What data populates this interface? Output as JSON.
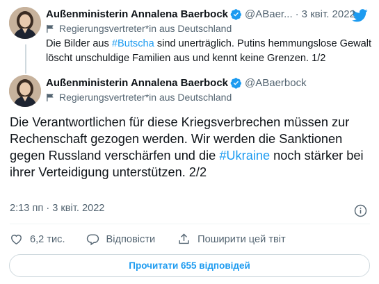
{
  "tweet1": {
    "name": "Außenministerin Annalena Baerbock",
    "handle": "@ABaer...",
    "dot": "·",
    "date": "3 квіт. 2022",
    "label": "Regierungsvertreter*in aus Deutschland",
    "text_a": "Die Bilder aus ",
    "hashtag": "#Butscha",
    "text_b": " sind unerträglich. Putins hemmungslose Gewalt löscht unschuldige Familien aus und kennt keine Grenzen. 1/2"
  },
  "tweet2": {
    "name": "Außenministerin Annalena Baerbock",
    "handle": "@ABaerbock",
    "label": "Regierungsvertreter*in aus Deutschland",
    "text_a": "Die Verantwortlichen für diese Kriegsverbrechen müssen zur Rechenschaft gezogen werden. Wir werden die Sanktionen gegen Russland verschärfen und die ",
    "hashtag": "#Ukraine",
    "text_b": " noch stärker bei ihrer Verteidigung unterstützen. 2/2",
    "timestamp": "2:13 пп · 3 квіт. 2022"
  },
  "actions": {
    "likes": "6,2 тис.",
    "reply": "Відповісти",
    "share": "Поширити цей твіт"
  },
  "read_replies": "Прочитати 655 відповідей",
  "colors": {
    "accent": "#1d9bf0",
    "text": "#0f1419",
    "muted": "#536471",
    "border": "#cfd9de"
  },
  "icons": [
    "twitter-logo-icon",
    "verified-badge-icon",
    "government-flag-icon",
    "info-icon",
    "heart-icon",
    "reply-icon",
    "share-icon"
  ]
}
